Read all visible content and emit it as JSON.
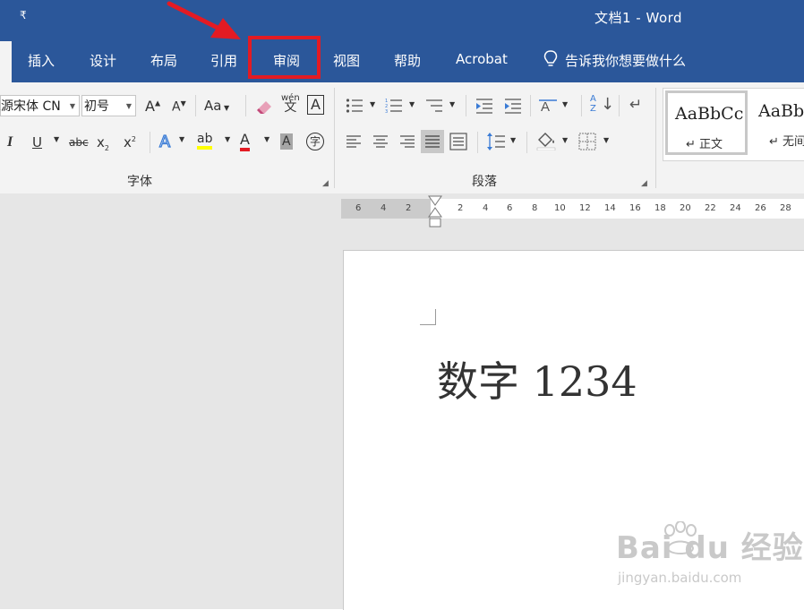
{
  "window": {
    "title": "文档1 - Word",
    "qat_symbol": "₹"
  },
  "tabs": [
    {
      "label": "插入"
    },
    {
      "label": "设计"
    },
    {
      "label": "布局"
    },
    {
      "label": "引用"
    },
    {
      "label": "审阅",
      "highlighted": true
    },
    {
      "label": "视图"
    },
    {
      "label": "帮助"
    },
    {
      "label": "Acrobat"
    }
  ],
  "tell_me": {
    "text": "告诉我你想要做什么",
    "icon": "lightbulb-icon"
  },
  "annotation": {
    "highlight_color": "#e31b23",
    "arrow_color": "#e31b23"
  },
  "ribbon": {
    "font_group": {
      "label": "字体",
      "font_name": "思源宋体 CN",
      "font_size": "初号",
      "grow_font": "A",
      "shrink_font": "A",
      "change_case": "Aa",
      "phonetic_top": "wén",
      "phonetic_bottom": "文",
      "char_border": "A",
      "italic": "I",
      "underline": "U",
      "strikethrough": "abc",
      "subscript": "x",
      "subscript_mark": "2",
      "superscript": "x",
      "superscript_mark": "2",
      "text_effects": "A",
      "highlight": "ab",
      "font_color": "A",
      "char_shading": "A",
      "enclose_char": "字"
    },
    "paragraph_group": {
      "label": "段落",
      "sort_top": "A",
      "sort_bottom": "Z"
    },
    "styles": [
      {
        "sample": "AaBbCc",
        "name": "正文"
      },
      {
        "sample": "AaBb",
        "name": "无间"
      }
    ]
  },
  "ruler": {
    "left_numbers": [
      "6",
      "4",
      "2"
    ],
    "right_numbers": [
      "2",
      "4",
      "6",
      "8",
      "10",
      "12",
      "14",
      "16",
      "18",
      "20",
      "22",
      "24",
      "26",
      "28"
    ]
  },
  "document": {
    "text": "数字 1234"
  },
  "watermark": {
    "main": "Bai du 经验",
    "sub": "jingyan.baidu.com"
  },
  "colors": {
    "ribbon_blue": "#2b579a",
    "highlight_yellow": "#ffff00",
    "font_red": "#e31b23"
  }
}
